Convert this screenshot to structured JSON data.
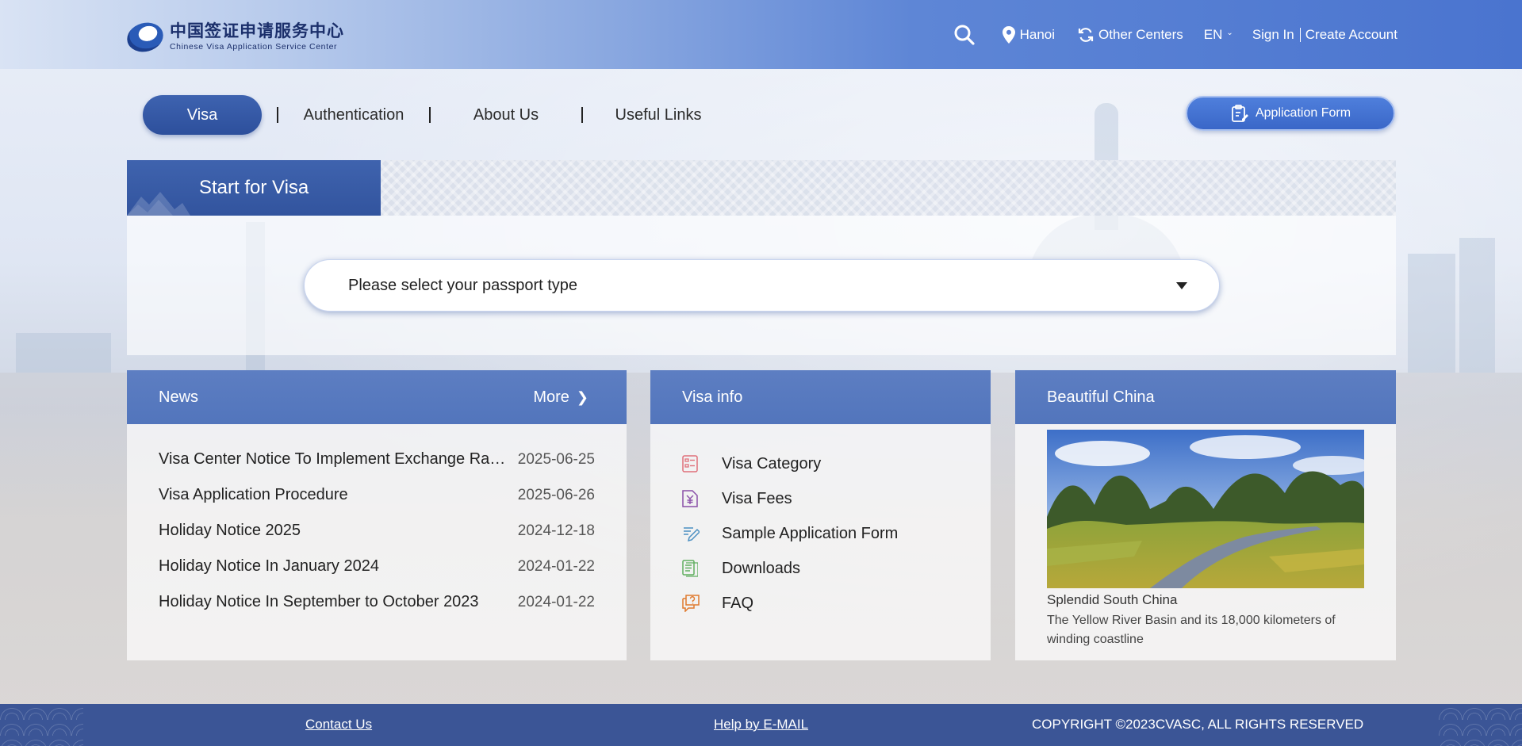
{
  "header": {
    "logo_cn": "中国签证申请服务中心",
    "logo_en": "Chinese Visa Application Service Center",
    "search_icon": "search-icon",
    "location_icon": "map-pin-icon",
    "location": "Hanoi",
    "other_centers_icon": "refresh-icon",
    "other_centers": "Other Centers",
    "language": "EN",
    "sign_in": "Sign In",
    "create_account": "Create Account"
  },
  "nav": {
    "tabs": [
      {
        "label": "Visa",
        "active": true
      },
      {
        "label": "Authentication"
      },
      {
        "label": "About Us"
      },
      {
        "label": "Useful Links"
      }
    ],
    "application_form": "Application Form"
  },
  "start_visa": {
    "title": "Start for Visa",
    "passport_placeholder": "Please select your passport type"
  },
  "news": {
    "title": "News",
    "more": "More",
    "items": [
      {
        "title": "Visa Center Notice To Implement Exchange Rate Adjustment",
        "date": "2025-06-25"
      },
      {
        "title": "Visa Application Procedure",
        "date": "2025-06-26"
      },
      {
        "title": "Holiday Notice 2025",
        "date": "2024-12-18"
      },
      {
        "title": "Holiday Notice In January 2024",
        "date": "2024-01-22"
      },
      {
        "title": "Holiday Notice In September to October 2023",
        "date": "2024-01-22"
      }
    ]
  },
  "visa_info": {
    "title": "Visa info",
    "items": [
      {
        "label": "Visa Category",
        "icon": "list-icon",
        "color": "#e0707a"
      },
      {
        "label": "Visa Fees",
        "icon": "yen-document-icon",
        "color": "#8a4fa8"
      },
      {
        "label": "Sample Application Form",
        "icon": "pen-icon",
        "color": "#4a8fc2"
      },
      {
        "label": "Downloads",
        "icon": "document-icon",
        "color": "#5fae5f"
      },
      {
        "label": "FAQ",
        "icon": "question-chat-icon",
        "color": "#e07a2e"
      }
    ]
  },
  "beautiful_china": {
    "title": "Beautiful China",
    "caption_title": "Splendid South China",
    "caption_text": "The Yellow River Basin and its 18,000 kilometers of winding coastline"
  },
  "footer": {
    "contact": "Contact Us",
    "help": "Help by E-MAIL",
    "copyright": "COPYRIGHT ©2023CVASC, ALL RIGHTS RESERVED"
  },
  "colors": {
    "primary": "#2d4f9c",
    "card_header": "#5275bc",
    "footer": "#3b5596"
  }
}
